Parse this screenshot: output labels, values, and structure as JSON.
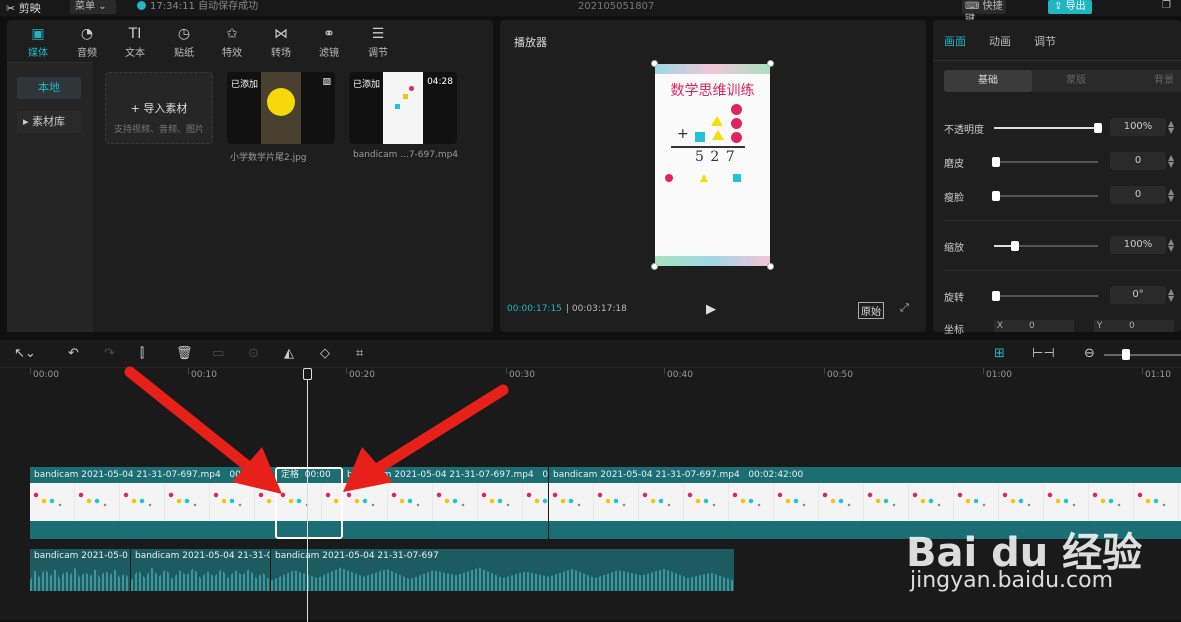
{
  "topbar": {
    "logo": "剪映",
    "menu": "菜单",
    "save_status": "17:34:11 自动保存成功",
    "project_name": "202105051807",
    "shortcut_label": "快捷键",
    "export_label": "导出"
  },
  "media_panel": {
    "tabs": [
      {
        "label": "媒体",
        "icon": "media-icon"
      },
      {
        "label": "音频",
        "icon": "audio-icon"
      },
      {
        "label": "文本",
        "icon": "text-icon"
      },
      {
        "label": "贴纸",
        "icon": "sticker-icon"
      },
      {
        "label": "特效",
        "icon": "effects-icon"
      },
      {
        "label": "转场",
        "icon": "transition-icon"
      },
      {
        "label": "滤镜",
        "icon": "filter-icon"
      },
      {
        "label": "调节",
        "icon": "adjust-icon"
      }
    ],
    "sidebar": {
      "local": "本地",
      "library": "素材库"
    },
    "import": {
      "title": "导入素材",
      "hint": "支持视频、音频、图片"
    },
    "items": [
      {
        "badge": "已添加",
        "caption": "小学数学片尾2.jpg",
        "duration": ""
      },
      {
        "badge": "已添加",
        "caption": "bandicam ...7-697.mp4",
        "duration": "04:28"
      }
    ]
  },
  "player": {
    "title": "播放器",
    "current_time": "00:00:17:15",
    "total_time": "00:03:17:18",
    "original_label": "原始",
    "frame_title": "数学思维训练",
    "frame_number": "5 2 7"
  },
  "properties": {
    "tabs": [
      "画面",
      "动画",
      "调节"
    ],
    "subtabs": [
      "基础",
      "蒙版",
      "背景"
    ],
    "rows": [
      {
        "label": "不透明度",
        "value": "100%",
        "level": 1.0
      },
      {
        "label": "磨皮",
        "value": "0",
        "level": 0.0
      },
      {
        "label": "瘦脸",
        "value": "0",
        "level": 0.0
      },
      {
        "label": "缩放",
        "value": "100%",
        "level": 0.2
      },
      {
        "label": "旋转",
        "value": "0°",
        "level": 0.0
      }
    ],
    "position": {
      "label": "坐标",
      "x_label": "X",
      "x_value": "0",
      "y_label": "Y",
      "y_value": "0"
    }
  },
  "timeline": {
    "ruler": [
      "00:00",
      "00:10",
      "00:20",
      "00:30",
      "00:40",
      "00:50",
      "01:00",
      "01:10"
    ],
    "video_clips": [
      {
        "name": "bandicam 2021-05-04 21-31-07-697.mp4",
        "duration": "00:00:18"
      },
      {
        "name": "定格",
        "duration": "00:00"
      },
      {
        "name": "bandicam 2021-05-04 21-31-07-697.mp4",
        "duration": "00"
      },
      {
        "name": "bandicam 2021-05-04 21-31-07-697.mp4",
        "duration": "00:02:42:00"
      }
    ],
    "audio_clips": [
      {
        "name": "bandicam 2021-05-0"
      },
      {
        "name": "bandicam 2021-05-04 21-31-0"
      },
      {
        "name": "bandicam 2021-05-04 21-31-07-697"
      }
    ]
  },
  "watermark": {
    "logo": "Bai du 经验",
    "url": "jingyan.baidu.com"
  },
  "colors": {
    "accent": "#22b5c4",
    "arrow": "#e8201a"
  }
}
